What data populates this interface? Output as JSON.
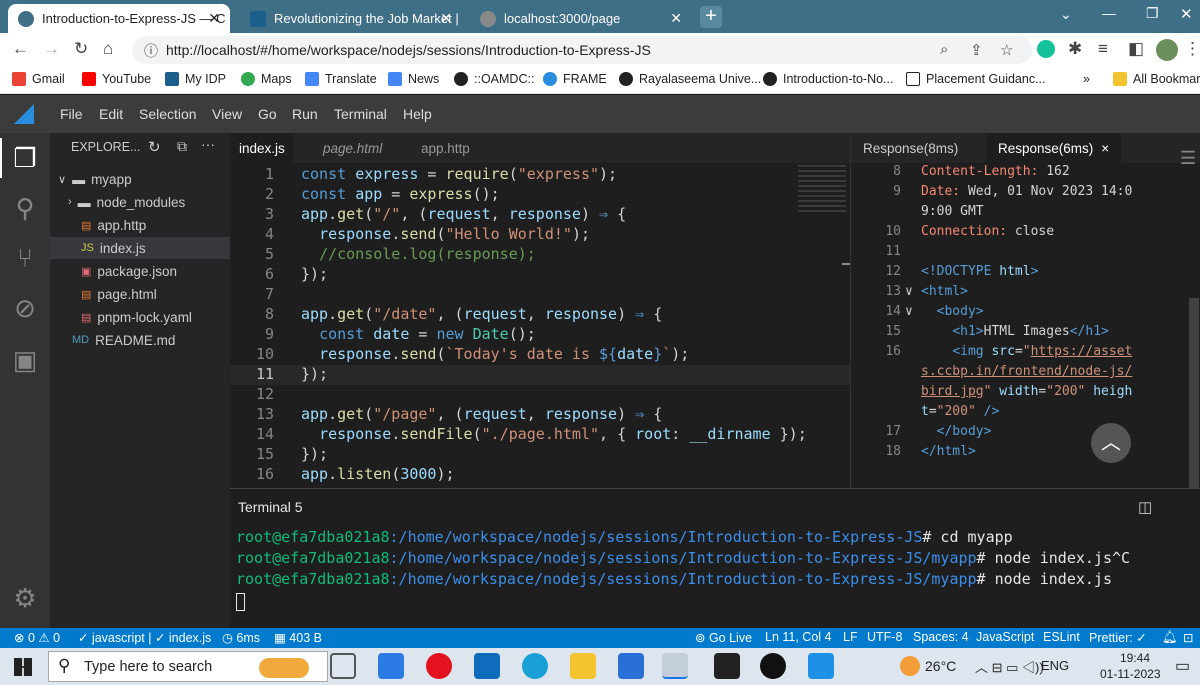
{
  "browser": {
    "tabs": [
      {
        "title": "Introduction-to-Express-JS — C",
        "color": "#3f6f86"
      },
      {
        "title": "Revolutionizing the Job Market |",
        "color": "#1b5e8c"
      },
      {
        "title": "localhost:3000/page",
        "color": "#888"
      }
    ],
    "new_tab_label": "+",
    "url": "http://localhost/#/home/workspace/nodejs/sessions/Introduction-to-Express-JS",
    "bookmarks": [
      "Gmail",
      "YouTube",
      "My IDP",
      "Maps",
      "Translate",
      "News",
      "::OAMDC::",
      "FRAME",
      "Rayalaseema Unive...",
      "Introduction-to-No...",
      "Placement Guidanc..."
    ],
    "all_bookmarks": "All Bookmarks",
    "more": "»"
  },
  "menubar": [
    "File",
    "Edit",
    "Selection",
    "View",
    "Go",
    "Run",
    "Terminal",
    "Help"
  ],
  "explorer": {
    "header": "EXPLORE...",
    "folder": "myapp",
    "items": [
      {
        "name": "node_modules",
        "kind": "folder"
      },
      {
        "name": "app.http",
        "kind": "http"
      },
      {
        "name": "index.js",
        "kind": "js"
      },
      {
        "name": "package.json",
        "kind": "json"
      },
      {
        "name": "page.html",
        "kind": "html"
      },
      {
        "name": "pnpm-lock.yaml",
        "kind": "yaml"
      }
    ],
    "readme": "README.md"
  },
  "editor": {
    "tabs": [
      "index.js",
      "page.html",
      "app.http"
    ],
    "lines": [
      "1",
      "2",
      "3",
      "4",
      "5",
      "6",
      "7",
      "8",
      "9",
      "10",
      "11",
      "12",
      "13",
      "14",
      "15",
      "16"
    ]
  },
  "response": {
    "tabs": [
      "Response(8ms)",
      "Response(6ms)"
    ],
    "close": "×",
    "line_numbers": [
      "8",
      "9",
      "",
      "10",
      "11",
      "12",
      "13",
      "14",
      "15",
      "16",
      "",
      "",
      "",
      "17",
      "18"
    ]
  },
  "terminal": {
    "title": "Terminal 5",
    "user": "root@efa7dba021a8",
    "lines": [
      {
        "path": ":/home/workspace/nodejs/sessions/Introduction-to-Express-JS",
        "cmd": "# cd myapp"
      },
      {
        "path": ":/home/workspace/nodejs/sessions/Introduction-to-Express-JS/myapp",
        "cmd": "# node index.js^C"
      },
      {
        "path": ":/home/workspace/nodejs/sessions/Introduction-to-Express-JS/myapp",
        "cmd": "# node index.js"
      }
    ]
  },
  "statusbar": {
    "errors": "0",
    "warnings": "0",
    "lang_info": "javascript | ✓ index.js",
    "time": "6ms",
    "size": "403 B",
    "go_live": "Go Live",
    "position": "Ln 11, Col 4",
    "eol": "LF",
    "encoding": "UTF-8",
    "spaces": "Spaces: 4",
    "language": "JavaScript",
    "eslint": "ESLint",
    "prettier": "Prettier: ✓"
  },
  "taskbar": {
    "search_placeholder": "Type here to search",
    "temperature": "26°C",
    "lang": "ENG",
    "time": "19:44",
    "date": "01-11-2023"
  }
}
